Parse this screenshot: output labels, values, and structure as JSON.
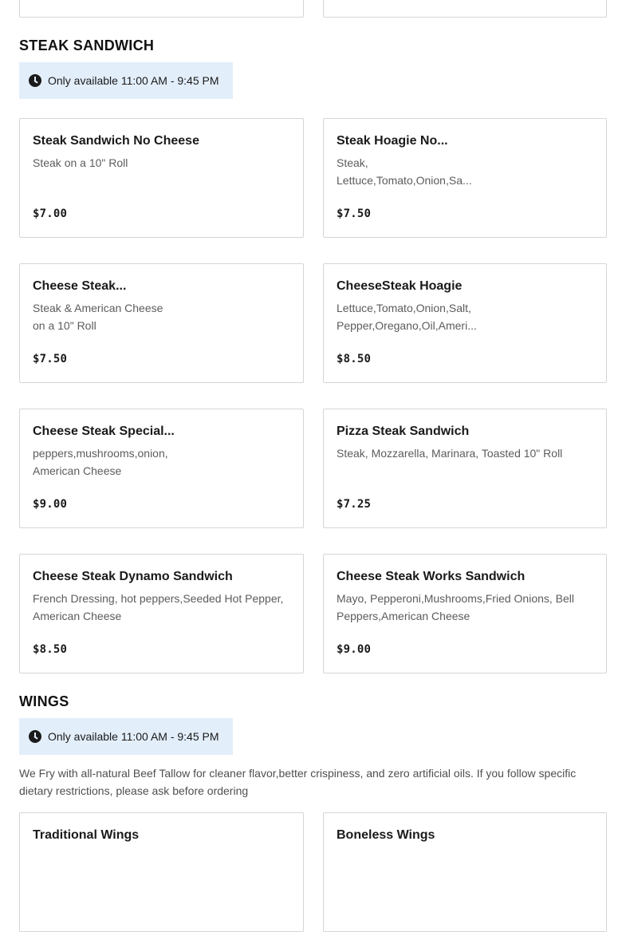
{
  "steak_section": {
    "title": "STEAK SANDWICH",
    "availability": "Only available 11:00 AM - 9:45 PM",
    "items": [
      {
        "name": "Steak Sandwich No Cheese",
        "desc_line1": "Steak on a 10\" Roll",
        "desc_line2": "",
        "price": "$7.00"
      },
      {
        "name": "Steak Hoagie No...",
        "desc_line1": "Steak,",
        "desc_line2": "Lettuce,Tomato,Onion,Sa...",
        "price": "$7.50"
      },
      {
        "name": "Cheese Steak...",
        "desc_line1": "Steak & American Cheese",
        "desc_line2": "on a 10\" Roll",
        "price": "$7.50"
      },
      {
        "name": "CheeseSteak Hoagie",
        "desc_line1": "Lettuce,Tomato,Onion,Salt,",
        "desc_line2": "Pepper,Oregano,Oil,Ameri...",
        "price": "$8.50"
      },
      {
        "name": "Cheese Steak Special...",
        "desc_line1": "peppers,mushrooms,onion,",
        "desc_line2": "American Cheese",
        "price": "$9.00"
      },
      {
        "name": "Pizza Steak Sandwich",
        "desc_line1": "Steak, Mozzarella, Marinara, Toasted 10\" Roll",
        "desc_line2": "",
        "price": "$7.25"
      },
      {
        "name": "Cheese Steak Dynamo Sandwich",
        "desc_line1": "French Dressing, hot peppers,Seeded Hot Pepper,",
        "desc_line2": "American Cheese",
        "price": "$8.50"
      },
      {
        "name": "Cheese Steak Works Sandwich",
        "desc_line1": "Mayo, Pepperoni,Mushrooms,Fried Onions, Bell",
        "desc_line2": "Peppers,American Cheese",
        "price": "$9.00"
      }
    ]
  },
  "wings_section": {
    "title": "WINGS",
    "availability": "Only available 11:00 AM - 9:45 PM",
    "note_line1": "We Fry with all-natural Beef Tallow for cleaner flavor,better crispiness, and zero artificial oils. If you follow specific",
    "note_line2": "dietary restrictions, please ask before ordering",
    "items": [
      {
        "name": "Traditional Wings"
      },
      {
        "name": "Boneless Wings"
      }
    ]
  }
}
